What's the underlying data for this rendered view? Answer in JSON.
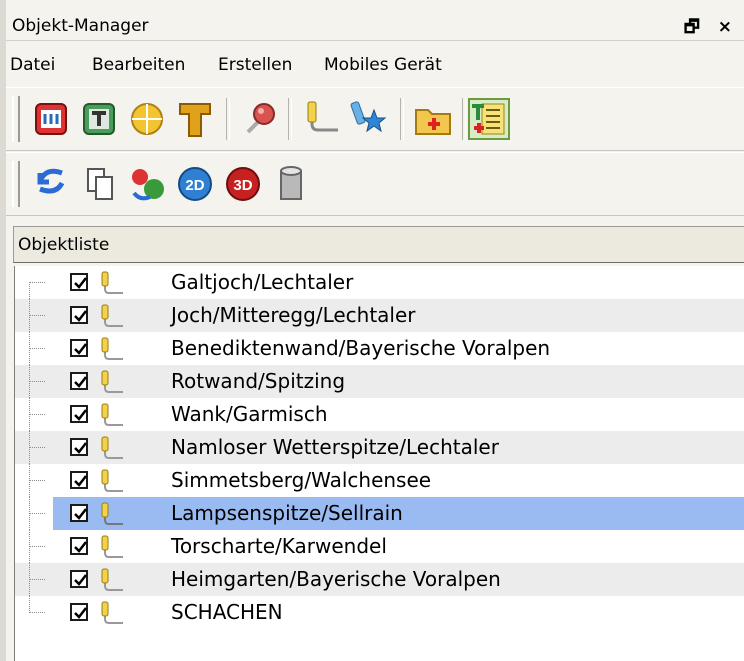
{
  "window": {
    "title": "Objekt-Manager",
    "controls": "🗗 ×"
  },
  "menu": [
    "Datei",
    "Bearbeiten",
    "Erstellen",
    "Mobiles Gerät"
  ],
  "toolbar1": [
    "folder-group-icon",
    "text-tool-icon",
    "crosshair-icon",
    "text-t-icon",
    "pin-icon",
    "track-pen-icon",
    "star-pen-icon",
    "folder-add-icon",
    "list-edit-icon"
  ],
  "toolbar2": [
    "undo-icon",
    "copy-icon",
    "refresh-icon",
    "view-2d-icon",
    "view-3d-icon",
    "database-icon"
  ],
  "list": {
    "header": "Objektliste",
    "items": [
      "Galtjoch/Lechtaler",
      "Joch/Mitteregg/Lechtaler",
      "Benediktenwand/Bayerische Voralpen",
      "Rotwand/Spitzing",
      "Wank/Garmisch",
      "Namloser Wetterspitze/Lechtaler",
      "Simmetsberg/Walchensee",
      "Lampsenspitze/Sellrain",
      "Torscharte/Karwendel",
      "Heimgarten/Bayerische Voralpen",
      "SCHACHEN"
    ],
    "selected": "Lampsenspitze/Sellrain"
  },
  "colors": {
    "selection": "#99bbf1",
    "alt_row": "#ececec"
  }
}
